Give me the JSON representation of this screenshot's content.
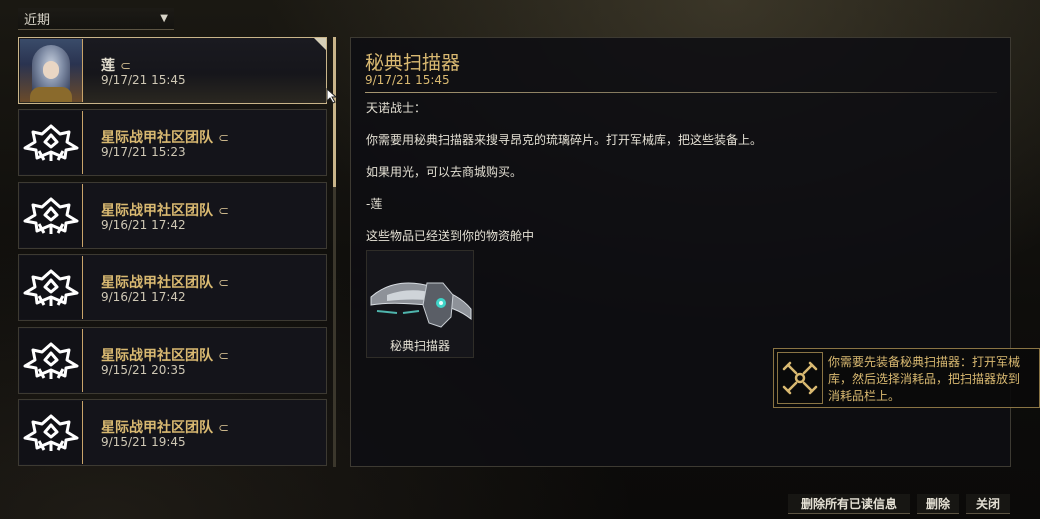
{
  "filter": {
    "selected": "近期"
  },
  "inbox": {
    "items": [
      {
        "sender": "莲",
        "date": "9/17/21 15:45",
        "selected": true,
        "icon": "avatar-lotus"
      },
      {
        "sender": "星际战甲社区团队",
        "date": "9/17/21 15:23",
        "selected": false,
        "icon": "warframe-logo-icon"
      },
      {
        "sender": "星际战甲社区团队",
        "date": "9/16/21 17:42",
        "selected": false,
        "icon": "warframe-logo-icon"
      },
      {
        "sender": "星际战甲社区团队",
        "date": "9/16/21 17:42",
        "selected": false,
        "icon": "warframe-logo-icon"
      },
      {
        "sender": "星际战甲社区团队",
        "date": "9/15/21 20:35",
        "selected": false,
        "icon": "warframe-logo-icon"
      },
      {
        "sender": "星际战甲社区团队",
        "date": "9/15/21 19:45",
        "selected": false,
        "icon": "warframe-logo-icon"
      }
    ]
  },
  "message": {
    "title": "秘典扫描器",
    "date": "9/17/21 15:45",
    "lines": [
      "天诺战士：",
      "你需要用秘典扫描器来搜寻昂克的琉璃碎片。打开军械库，把这些装备上。",
      "如果用光，可以去商城购买。",
      "-莲",
      "这些物品已经送到你的物资舱中"
    ],
    "attachment": {
      "label": "秘典扫描器"
    }
  },
  "tooltip": {
    "text": "你需要先装备秘典扫描器：打开军械库，然后选择消耗品，把扫描器放到消耗品栏上。"
  },
  "actions": {
    "delete_read": "删除所有已读信息",
    "delete": "删除",
    "close": "关闭"
  },
  "colors": {
    "accent_gold": "#d9b971",
    "border": "#3d3a32",
    "selected_border": "#c9b58a"
  }
}
